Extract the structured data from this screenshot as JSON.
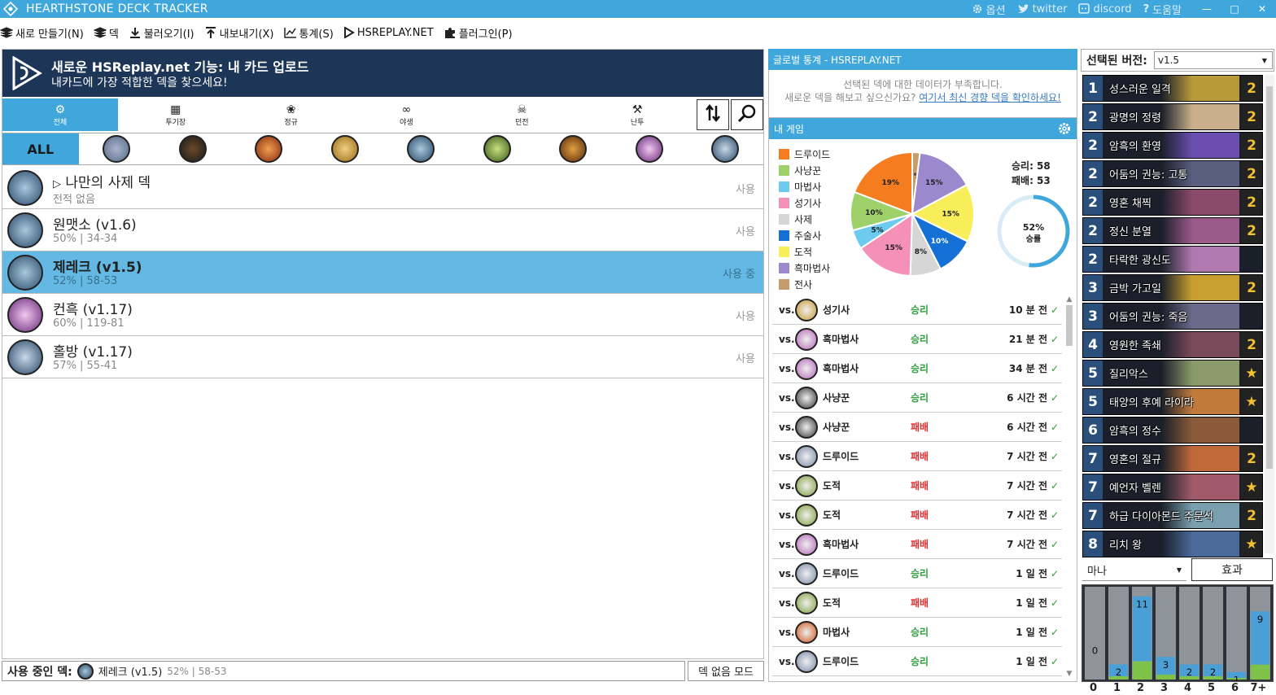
{
  "titlebar": {
    "title": "HEARTHSTONE DECK TRACKER",
    "options": "옵션",
    "twitter": "twitter",
    "discord": "discord",
    "help": "도움말"
  },
  "menu": {
    "new": "새로 만들기(N)",
    "deck": "덱",
    "import": "불러오기(I)",
    "export": "내보내기(X)",
    "stats": "통계(S)",
    "hsreplay": "HSREPLAY.NET",
    "plugins": "플러그인(P)"
  },
  "banner": {
    "title": "새로운 HSReplay.net 기능: 내 카드 업로드",
    "subtitle": "내카드에 가장 적합한 덱을 찾으세요!"
  },
  "formats": [
    {
      "label": "전체",
      "icon": "gear-icon"
    },
    {
      "label": "투기장",
      "icon": "arena-icon"
    },
    {
      "label": "정규",
      "icon": "standard-icon"
    },
    {
      "label": "야생",
      "icon": "wild-icon"
    },
    {
      "label": "던전",
      "icon": "dungeon-icon"
    },
    {
      "label": "난투",
      "icon": "brawl-icon"
    }
  ],
  "class_filter": {
    "all_label": "ALL",
    "classes": [
      {
        "name": "druid",
        "color": "#7a8aa8"
      },
      {
        "name": "hunter",
        "color": "#3b3b3b"
      },
      {
        "name": "mage",
        "color": "#d0561c"
      },
      {
        "name": "paladin",
        "color": "#c99a32"
      },
      {
        "name": "priest",
        "color": "#5a8fae"
      },
      {
        "name": "rogue",
        "color": "#7ea03a"
      },
      {
        "name": "shaman",
        "color": "#c0621c"
      },
      {
        "name": "warlock",
        "color": "#b467b8"
      },
      {
        "name": "warrior",
        "color": "#4a7ba8"
      }
    ]
  },
  "decks": [
    {
      "name": "나만의 사제 덱",
      "stat": "전적 없음",
      "use": "사용",
      "selected": false,
      "color": "#4f7894"
    },
    {
      "name": "원맷소 (v1.6)",
      "stat": "50% | 34-34",
      "use": "사용",
      "selected": false,
      "color": "#4f7894"
    },
    {
      "name": "제레크 (v1.5)",
      "stat": "52% | 58-53",
      "use": "사용 중",
      "selected": true,
      "color": "#4f7894"
    },
    {
      "name": "컨흑 (v1.17)",
      "stat": "60% | 119-81",
      "use": "사용",
      "selected": false,
      "color": "#a55cb0"
    },
    {
      "name": "홀방 (v1.17)",
      "stat": "57% | 55-41",
      "use": "사용",
      "selected": false,
      "color": "#5a7fa8"
    }
  ],
  "status": {
    "label": "사용 중인 덱:",
    "deck": "제레크 (v1.5)",
    "stat": "52% | 58-53",
    "nodeck": "덱 없음 모드"
  },
  "global": {
    "header": "글로벌 통계 - HSREPLAY.NET",
    "line1": "선택된 덱에 대한 데이터가 부족합니다.",
    "line2": "새로운 덱을 해보고 싶으신가요?",
    "link": "여기서 최신 경향 덱을 확인하세요!"
  },
  "mygames": {
    "header": "내 게임",
    "legend": [
      {
        "label": "드루이드",
        "color": "#f57c1f"
      },
      {
        "label": "사냥꾼",
        "color": "#9fd16a"
      },
      {
        "label": "마법사",
        "color": "#6ccbef"
      },
      {
        "label": "성기사",
        "color": "#f590b8"
      },
      {
        "label": "사제",
        "color": "#d6d6d6"
      },
      {
        "label": "주술사",
        "color": "#1570d6"
      },
      {
        "label": "도적",
        "color": "#f7ee5a"
      },
      {
        "label": "흑마법사",
        "color": "#9c88cc"
      },
      {
        "label": "전사",
        "color": "#c69c6d"
      }
    ],
    "wins": "승리: 58",
    "losses": "패배: 53",
    "winrate_label": "52%",
    "winrate_word": "승률",
    "winrate": 0.52,
    "games": [
      {
        "vs": "vs.",
        "class": "성기사",
        "result": "승리",
        "win": true,
        "time": "10 분 전",
        "color": "#c99a32"
      },
      {
        "vs": "vs.",
        "class": "흑마법사",
        "result": "승리",
        "win": true,
        "time": "21 분 전",
        "color": "#b467b8"
      },
      {
        "vs": "vs.",
        "class": "흑마법사",
        "result": "승리",
        "win": true,
        "time": "34 분 전",
        "color": "#b467b8"
      },
      {
        "vs": "vs.",
        "class": "사냥꾼",
        "result": "승리",
        "win": true,
        "time": "6 시간 전",
        "color": "#3b3b3b"
      },
      {
        "vs": "vs.",
        "class": "사냥꾼",
        "result": "패배",
        "win": false,
        "time": "6 시간 전",
        "color": "#3b3b3b"
      },
      {
        "vs": "vs.",
        "class": "드루이드",
        "result": "패배",
        "win": false,
        "time": "7 시간 전",
        "color": "#7a8aa8"
      },
      {
        "vs": "vs.",
        "class": "도적",
        "result": "패배",
        "win": false,
        "time": "7 시간 전",
        "color": "#7ea03a"
      },
      {
        "vs": "vs.",
        "class": "도적",
        "result": "패배",
        "win": false,
        "time": "7 시간 전",
        "color": "#7ea03a"
      },
      {
        "vs": "vs.",
        "class": "흑마법사",
        "result": "패배",
        "win": false,
        "time": "7 시간 전",
        "color": "#b467b8"
      },
      {
        "vs": "vs.",
        "class": "드루이드",
        "result": "승리",
        "win": true,
        "time": "1 일 전",
        "color": "#7a8aa8"
      },
      {
        "vs": "vs.",
        "class": "도적",
        "result": "패배",
        "win": false,
        "time": "1 일 전",
        "color": "#7ea03a"
      },
      {
        "vs": "vs.",
        "class": "마법사",
        "result": "승리",
        "win": true,
        "time": "1 일 전",
        "color": "#d0561c"
      },
      {
        "vs": "vs.",
        "class": "드루이드",
        "result": "승리",
        "win": true,
        "time": "1 일 전",
        "color": "#7a8aa8"
      }
    ]
  },
  "chart_data": {
    "type": "pie",
    "slices": [
      {
        "label": "전사",
        "value": 2,
        "text": "2%",
        "color": "#c69c6d"
      },
      {
        "label": "흑마법사",
        "value": 15,
        "text": "15%",
        "color": "#9c88cc"
      },
      {
        "label": "도적",
        "value": 15,
        "text": "15%",
        "color": "#f7ee5a"
      },
      {
        "label": "주술사",
        "value": 10,
        "text": "10%",
        "color": "#1570d6"
      },
      {
        "label": "사제",
        "value": 8,
        "text": "8%",
        "color": "#d6d6d6"
      },
      {
        "label": "성기사",
        "value": 15,
        "text": "15%",
        "color": "#f590b8"
      },
      {
        "label": "마법사",
        "value": 5,
        "text": "5%",
        "color": "#6ccbef"
      },
      {
        "label": "사냥꾼",
        "value": 10,
        "text": "10%",
        "color": "#9fd16a"
      },
      {
        "label": "드루이드",
        "value": 19,
        "text": "19%",
        "color": "#f57c1f"
      }
    ]
  },
  "version": {
    "label": "선택된 버전:",
    "value": "v1.5"
  },
  "cards": [
    {
      "cost": "1",
      "name": "성스러운 일격",
      "count": "2",
      "art": "#b89a3a"
    },
    {
      "cost": "2",
      "name": "광명의 정령",
      "count": "2",
      "art": "#c9b08a"
    },
    {
      "cost": "2",
      "name": "암흑의 환영",
      "count": "2",
      "art": "#6a4fb0"
    },
    {
      "cost": "2",
      "name": "어둠의 권능: 고통",
      "count": "2",
      "art": "#5a5f80"
    },
    {
      "cost": "2",
      "name": "영혼 채찍",
      "count": "2",
      "art": "#8a4a6a"
    },
    {
      "cost": "2",
      "name": "정신 분열",
      "count": "2",
      "art": "#9a5a8a"
    },
    {
      "cost": "2",
      "name": "타락한 광신도",
      "count": "",
      "art": "#b07ab0"
    },
    {
      "cost": "3",
      "name": "금박 가고일",
      "count": "2",
      "art": "#c9a030"
    },
    {
      "cost": "3",
      "name": "어둠의 권능: 죽음",
      "count": "",
      "art": "#6a6a8a"
    },
    {
      "cost": "4",
      "name": "영원한 족쇄",
      "count": "2",
      "art": "#7a4a5a"
    },
    {
      "cost": "5",
      "name": "질리악스",
      "count": "★",
      "art": "#8a9a6a"
    },
    {
      "cost": "5",
      "name": "태양의 후예 라이라",
      "count": "★",
      "art": "#c07a3a"
    },
    {
      "cost": "6",
      "name": "암흑의 정수",
      "count": "",
      "art": "#8a5a3a"
    },
    {
      "cost": "7",
      "name": "영혼의 절규",
      "count": "2",
      "art": "#c06a3a"
    },
    {
      "cost": "7",
      "name": "예언자 벨렌",
      "count": "★",
      "art": "#a05a6a"
    },
    {
      "cost": "7",
      "name": "하급 다이아몬드 주문석",
      "count": "2",
      "art": "#7aa0b0"
    },
    {
      "cost": "8",
      "name": "리치 왕",
      "count": "★",
      "art": "#4a6a9a"
    }
  ],
  "curve": {
    "mana_label": "마나",
    "effects_label": "효과",
    "axis": [
      "0",
      "1",
      "2",
      "3",
      "4",
      "5",
      "6",
      "7+"
    ],
    "counts": [
      0,
      2,
      11,
      3,
      2,
      2,
      1,
      9
    ]
  }
}
